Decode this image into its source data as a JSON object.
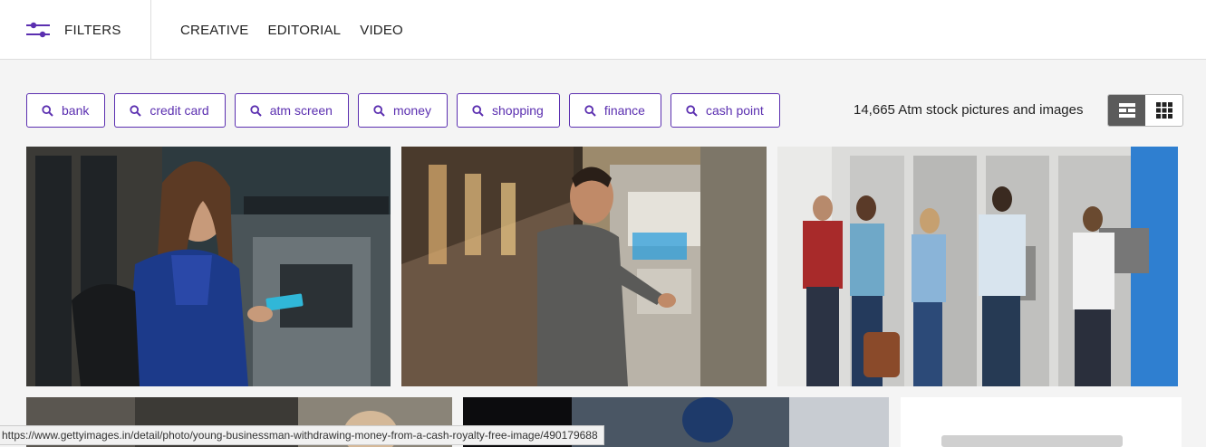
{
  "toolbar": {
    "filters_label": "FILTERS",
    "tabs": [
      {
        "label": "CREATIVE"
      },
      {
        "label": "EDITORIAL"
      },
      {
        "label": "VIDEO"
      }
    ]
  },
  "related_searches": [
    {
      "label": "bank"
    },
    {
      "label": "credit card"
    },
    {
      "label": "atm screen"
    },
    {
      "label": "money"
    },
    {
      "label": "shopping"
    },
    {
      "label": "finance"
    },
    {
      "label": "cash point"
    }
  ],
  "results": {
    "count_text": "14,665 Atm stock pictures and images",
    "view_modes": [
      {
        "icon": "mosaic-view-icon",
        "active": true
      },
      {
        "icon": "grid-view-icon",
        "active": false
      }
    ]
  },
  "status_bar": {
    "url": "https://www.gettyimages.in/detail/photo/young-businessman-withdrawing-money-from-a-cash-royalty-free-image/490179688"
  },
  "colors": {
    "accent": "#5b2fb0",
    "toggle_active": "#5b5b5b"
  }
}
